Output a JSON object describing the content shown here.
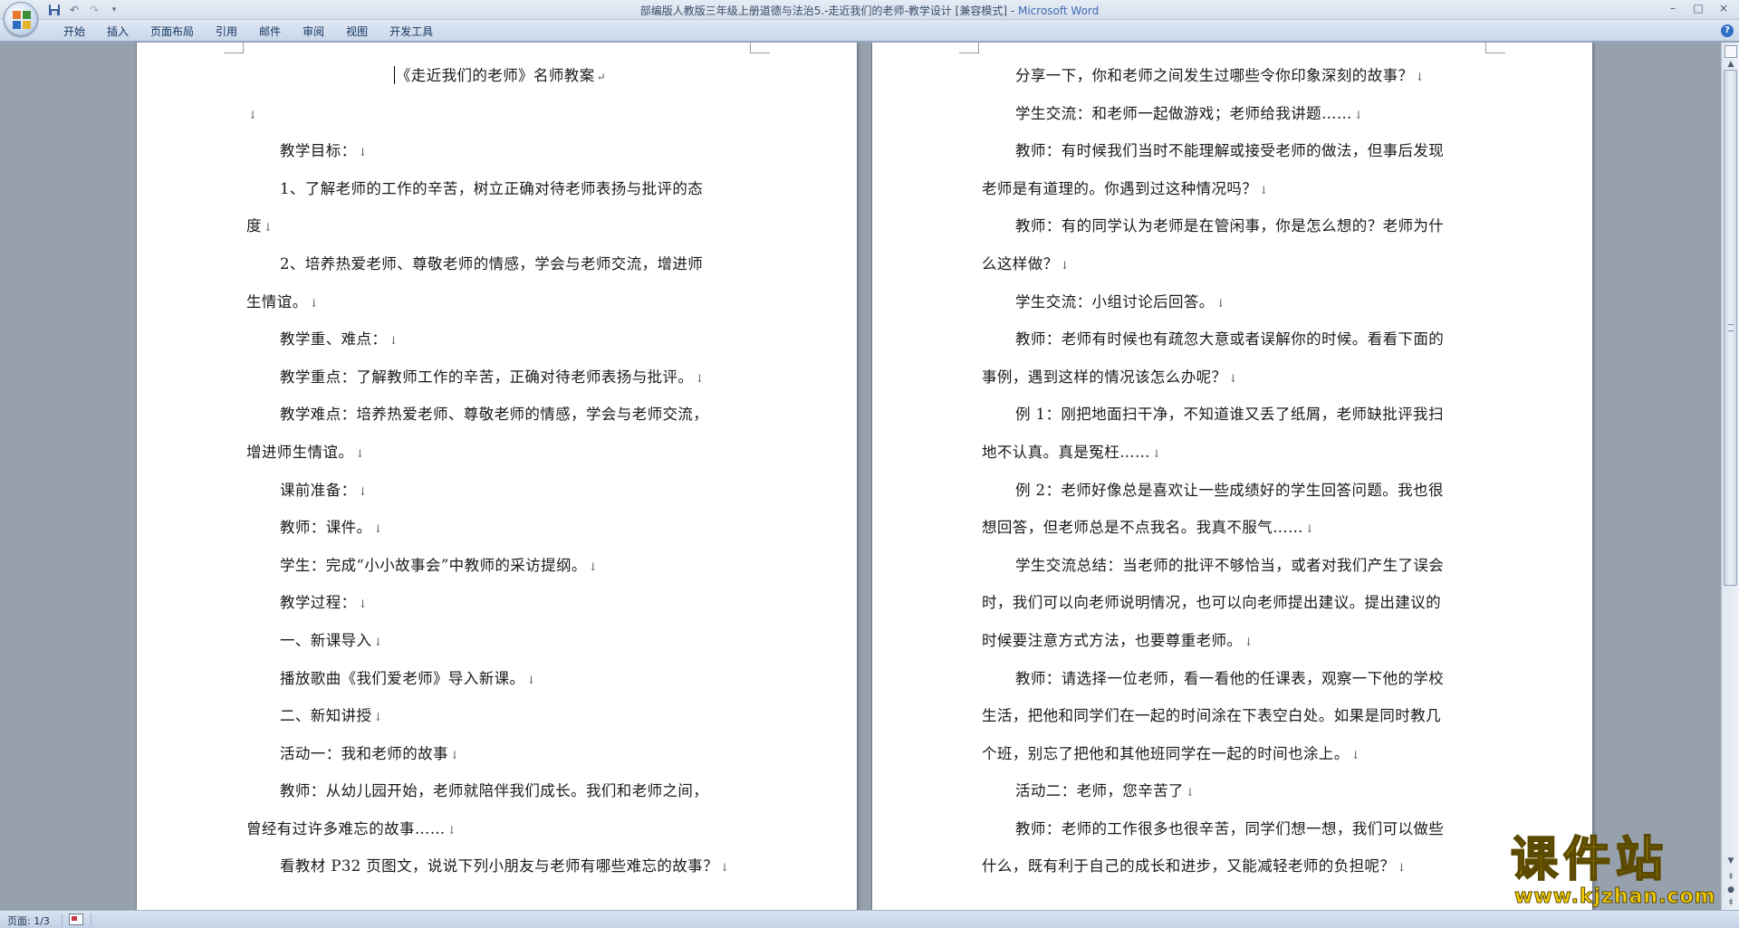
{
  "window": {
    "title_doc": "部编版人教版三年级上册道德与法治5.-走近我们的老师-教学设计 [兼容模式] - ",
    "title_app": "Microsoft Word",
    "controls": [
      "–",
      "□",
      "×"
    ]
  },
  "qat": {
    "save": "save-icon",
    "undo": "undo-icon",
    "redo": "redo-icon",
    "more": "▾"
  },
  "tabs": [
    "开始",
    "插入",
    "页面布局",
    "引用",
    "邮件",
    "审阅",
    "视图",
    "开发工具"
  ],
  "page1": {
    "title": "《走近我们的老师》名师教案",
    "lines": [
      {
        "text": "",
        "indent": false
      },
      {
        "text": "教学目标：",
        "indent": true
      },
      {
        "text": "1、了解老师的工作的辛苦，树立正确对待老师表扬与批评的态",
        "indent": true,
        "nomark": true
      },
      {
        "text": "度",
        "indent": false
      },
      {
        "text": "2、培养热爱老师、尊敬老师的情感，学会与老师交流，增进师",
        "indent": true,
        "nomark": true
      },
      {
        "text": "生情谊。",
        "indent": false
      },
      {
        "text": "教学重、难点：",
        "indent": true
      },
      {
        "text": "教学重点：了解教师工作的辛苦，正确对待老师表扬与批评。",
        "indent": true
      },
      {
        "text": "教学难点：培养热爱老师、尊敬老师的情感，学会与老师交流，",
        "indent": true,
        "nomark": true
      },
      {
        "text": "增进师生情谊。",
        "indent": false
      },
      {
        "text": "课前准备：",
        "indent": true
      },
      {
        "text": "教师：课件。",
        "indent": true
      },
      {
        "text": "学生：完成“小小故事会”中教师的采访提纲。",
        "indent": true
      },
      {
        "text": "教学过程：",
        "indent": true
      },
      {
        "text": "一、新课导入",
        "indent": true
      },
      {
        "text": "播放歌曲《我们爱老师》导入新课。",
        "indent": true
      },
      {
        "text": "二、新知讲授",
        "indent": true
      },
      {
        "text": "活动一：我和老师的故事",
        "indent": true
      },
      {
        "text": "教师：从幼儿园开始，老师就陪伴我们成长。我们和老师之间，",
        "indent": true,
        "nomark": true
      },
      {
        "text": "曾经有过许多难忘的故事……",
        "indent": false
      },
      {
        "text": "看教材 P32 页图文，说说下列小朋友与老师有哪些难忘的故事？",
        "indent": true
      }
    ]
  },
  "page2": {
    "lines": [
      {
        "text": "分享一下，你和老师之间发生过哪些令你印象深刻的故事？",
        "indent": true
      },
      {
        "text": "学生交流：和老师一起做游戏；老师给我讲题……",
        "indent": true
      },
      {
        "text": "教师：有时候我们当时不能理解或接受老师的做法，但事后发现",
        "indent": true,
        "nomark": true
      },
      {
        "text": "老师是有道理的。你遇到过这种情况吗？",
        "indent": false
      },
      {
        "text": "教师：有的同学认为老师是在管闲事，你是怎么想的？老师为什",
        "indent": true,
        "nomark": true
      },
      {
        "text": "么这样做？",
        "indent": false
      },
      {
        "text": "学生交流：小组讨论后回答。",
        "indent": true
      },
      {
        "text": "教师：老师有时候也有疏忽大意或者误解你的时候。看看下面的",
        "indent": true,
        "nomark": true
      },
      {
        "text": "事例，遇到这样的情况该怎么办呢？",
        "indent": false
      },
      {
        "text": "例 1：刚把地面扫干净，不知道谁又丢了纸屑，老师缺批评我扫",
        "indent": true,
        "nomark": true
      },
      {
        "text": "地不认真。真是冤枉……",
        "indent": false
      },
      {
        "text": "例 2：老师好像总是喜欢让一些成绩好的学生回答问题。我也很",
        "indent": true,
        "nomark": true
      },
      {
        "text": "想回答，但老师总是不点我名。我真不服气……",
        "indent": false
      },
      {
        "text": "学生交流总结：当老师的批评不够恰当，或者对我们产生了误会",
        "indent": true,
        "nomark": true
      },
      {
        "text": "时，我们可以向老师说明情况，也可以向老师提出建议。提出建议的",
        "indent": false,
        "nomark": true
      },
      {
        "text": "时候要注意方式方法，也要尊重老师。",
        "indent": false
      },
      {
        "text": "教师：请选择一位老师，看一看他的任课表，观察一下他的学校",
        "indent": true,
        "nomark": true
      },
      {
        "text": "生活，把他和同学们在一起的时间涂在下表空白处。如果是同时教几",
        "indent": false,
        "nomark": true
      },
      {
        "text": "个班，别忘了把他和其他班同学在一起的时间也涂上。",
        "indent": false
      },
      {
        "text": "活动二：老师，您辛苦了",
        "indent": true
      },
      {
        "text": "教师：老师的工作很多也很辛苦，同学们想一想，我们可以做些",
        "indent": true,
        "nomark": true
      },
      {
        "text": "什么，既有利于自己的成长和进步，又能减轻老师的负担呢？",
        "indent": false
      }
    ]
  },
  "paragraph_mark": "↓",
  "title_mark": "↵",
  "status": {
    "page": "页面: 1/3"
  },
  "watermark": {
    "cn": "课件站",
    "url": "www.kjzhan.com"
  }
}
